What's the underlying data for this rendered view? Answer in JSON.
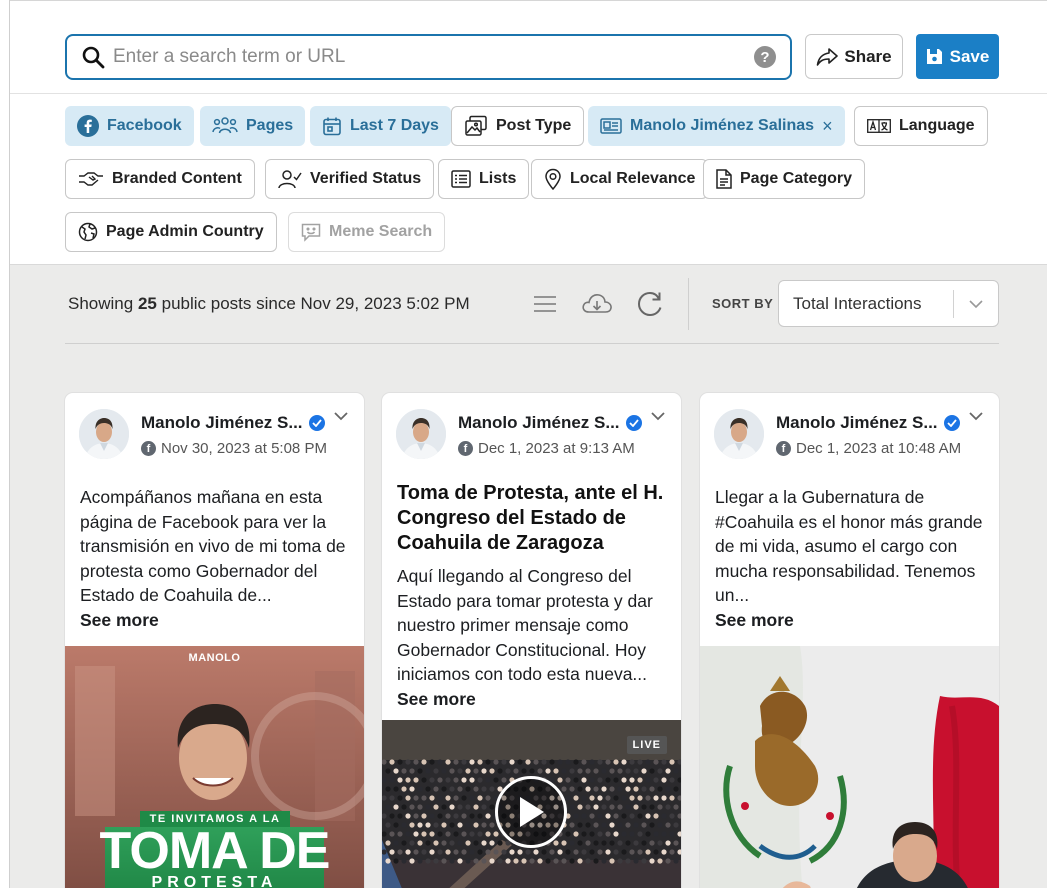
{
  "search": {
    "placeholder": "Enter a search term or URL",
    "help": "?"
  },
  "header_actions": {
    "share_label": "Share",
    "save_label": "Save"
  },
  "filters": {
    "facebook": "Facebook",
    "pages": "Pages",
    "date": "Last 7 Days",
    "post_type": "Post Type",
    "page_filter": "Manolo Jiménez Salinas",
    "page_filter_remove": "×",
    "language": "Language",
    "branded_content": "Branded Content",
    "verified_status": "Verified Status",
    "lists": "Lists",
    "local_relevance": "Local Relevance",
    "page_category": "Page Category",
    "page_admin_country": "Page Admin Country",
    "meme_search": "Meme Search"
  },
  "results": {
    "showing_prefix": "Showing",
    "count": "25",
    "showing_suffix": "public posts since Nov 29, 2023 5:02 PM",
    "sort_by_label": "SORT BY",
    "sort_value": "Total Interactions"
  },
  "posts": [
    {
      "author": "Manolo Jiménez S...",
      "date": "Nov 30, 2023 at 5:08 PM",
      "title": "",
      "text": "Acompáñanos mañana en esta página de Facebook para ver la transmisión en vivo de mi toma de protesta como Gobernador del Estado de Coahuila de...",
      "see_more": "See more",
      "image_texts": {
        "brand": "MANOLO",
        "line1": "TE INVITAMOS A LA",
        "line2": "TOMA DE",
        "line3": "PROTESTA"
      }
    },
    {
      "author": "Manolo Jiménez S...",
      "date": "Dec 1, 2023 at 9:13 AM",
      "title": "Toma de Protesta, ante el H. Congreso del Estado de Coahuila de Zaragoza",
      "text": "Aquí llegando al Congreso del Estado para tomar protesta y dar nuestro primer mensaje como Gobernador Constitucional. Hoy iniciamos con todo esta nueva...",
      "see_more": "See more",
      "live_badge": "LIVE"
    },
    {
      "author": "Manolo Jiménez S...",
      "date": "Dec 1, 2023 at 10:48 AM",
      "title": "",
      "text": "Llegar a la Gubernatura de #Coahuila es el honor más grande de mi vida, asumo el cargo con mucha responsabilidad. Tenemos un...",
      "see_more": "See more"
    }
  ],
  "colors": {
    "accent": "#1b74ad",
    "save": "#1b7fc6",
    "chip_active_bg": "#d7eaf5",
    "chip_active_text": "#2a6f99"
  }
}
